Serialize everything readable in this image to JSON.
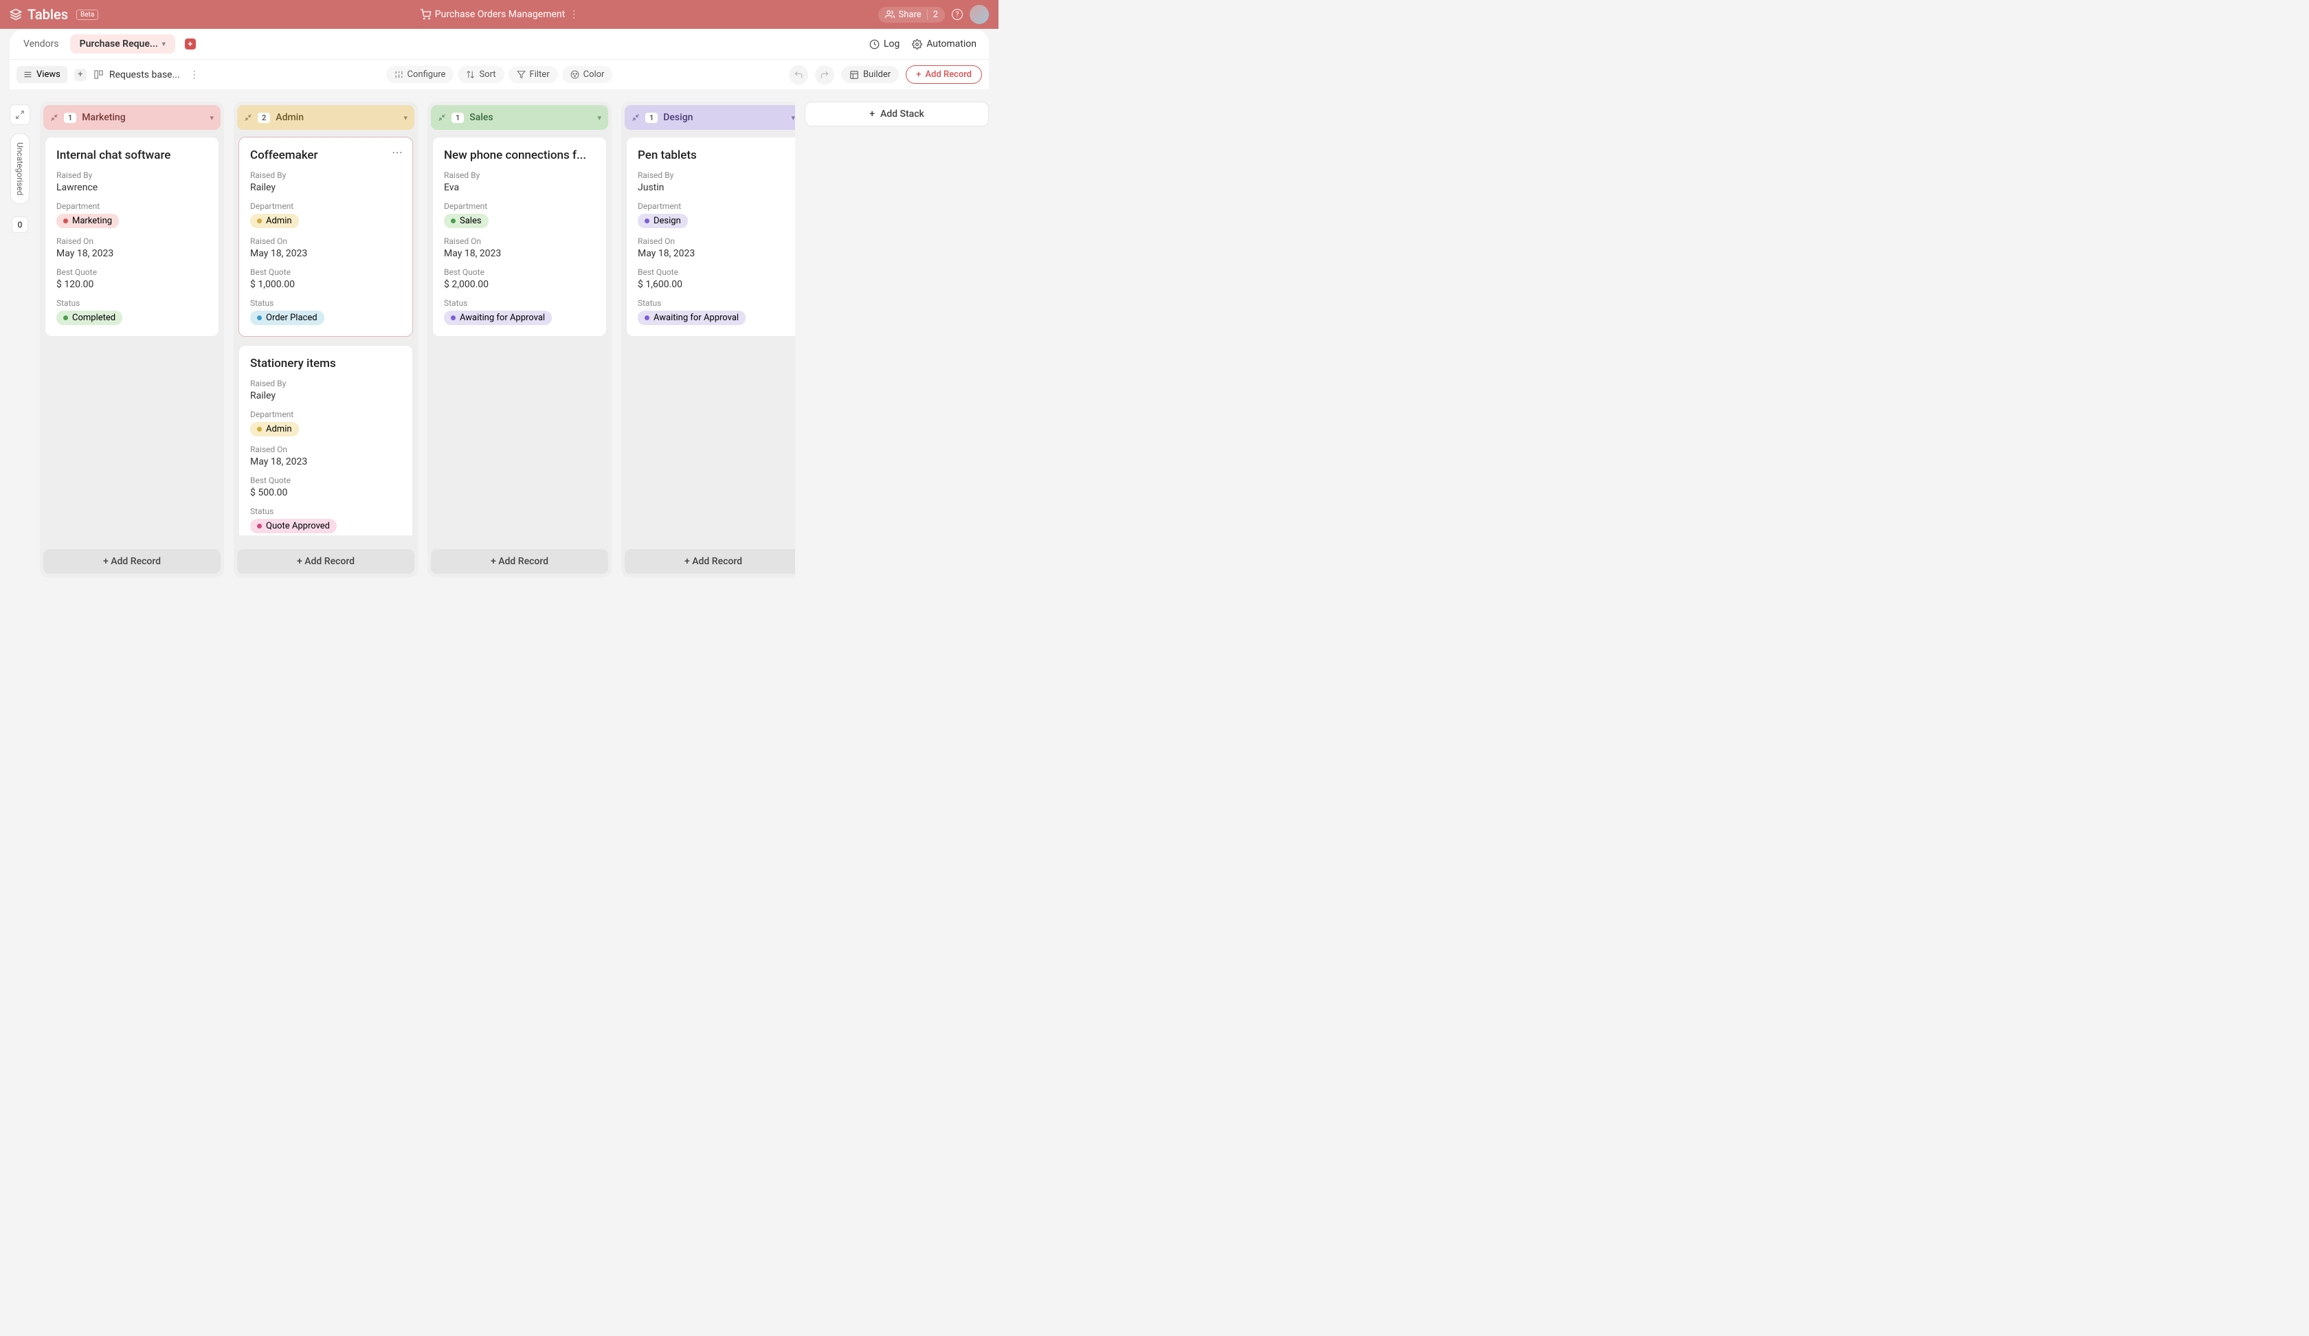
{
  "topbar": {
    "app_title": "Tables",
    "beta": "Beta",
    "page_title": "Purchase Orders Management",
    "share": "Share",
    "share_count": "2"
  },
  "tabs": {
    "vendors": "Vendors",
    "requests": "Purchase Reque...",
    "log": "Log",
    "automation": "Automation"
  },
  "toolbar": {
    "views": "Views",
    "view_name": "Requests base...",
    "configure": "Configure",
    "sort": "Sort",
    "filter": "Filter",
    "color": "Color",
    "builder": "Builder",
    "add_record": "Add Record"
  },
  "rail": {
    "uncategorised": "Uncategorised",
    "count": "0"
  },
  "labels": {
    "raised_by": "Raised By",
    "department": "Department",
    "raised_on": "Raised On",
    "best_quote": "Best Quote",
    "status": "Status",
    "add_record": "Add Record",
    "add_stack": "Add Stack"
  },
  "stacks": [
    {
      "name": "Marketing",
      "count": "1",
      "cls": "marketing",
      "cards": [
        {
          "title": "Internal chat software",
          "raised_by": "Lawrence",
          "dept": "Marketing",
          "dept_cls": "marketing",
          "raised_on": "May 18, 2023",
          "quote": "$ 120.00",
          "status": "Completed",
          "status_cls": "completed"
        }
      ]
    },
    {
      "name": "Admin",
      "count": "2",
      "cls": "admin",
      "cards": [
        {
          "title": "Coffeemaker",
          "raised_by": "Railey",
          "dept": "Admin",
          "dept_cls": "admin",
          "raised_on": "May 18, 2023",
          "quote": "$ 1,000.00",
          "status": "Order Placed",
          "status_cls": "orderplaced",
          "hover": true
        },
        {
          "title": "Stationery items",
          "raised_by": "Railey",
          "dept": "Admin",
          "dept_cls": "admin",
          "raised_on": "May 18, 2023",
          "quote": "$ 500.00",
          "status": "Quote Approved",
          "status_cls": "approved"
        }
      ]
    },
    {
      "name": "Sales",
      "count": "1",
      "cls": "sales",
      "cards": [
        {
          "title": "New phone connections f...",
          "raised_by": "Eva",
          "dept": "Sales",
          "dept_cls": "sales",
          "raised_on": "May 18, 2023",
          "quote": "$ 2,000.00",
          "status": "Awaiting for Approval",
          "status_cls": "awaiting"
        }
      ]
    },
    {
      "name": "Design",
      "count": "1",
      "cls": "design",
      "cards": [
        {
          "title": "Pen tablets",
          "raised_by": "Justin",
          "dept": "Design",
          "dept_cls": "design",
          "raised_on": "May 18, 2023",
          "quote": "$ 1,600.00",
          "status": "Awaiting for Approval",
          "status_cls": "awaiting"
        }
      ]
    }
  ]
}
